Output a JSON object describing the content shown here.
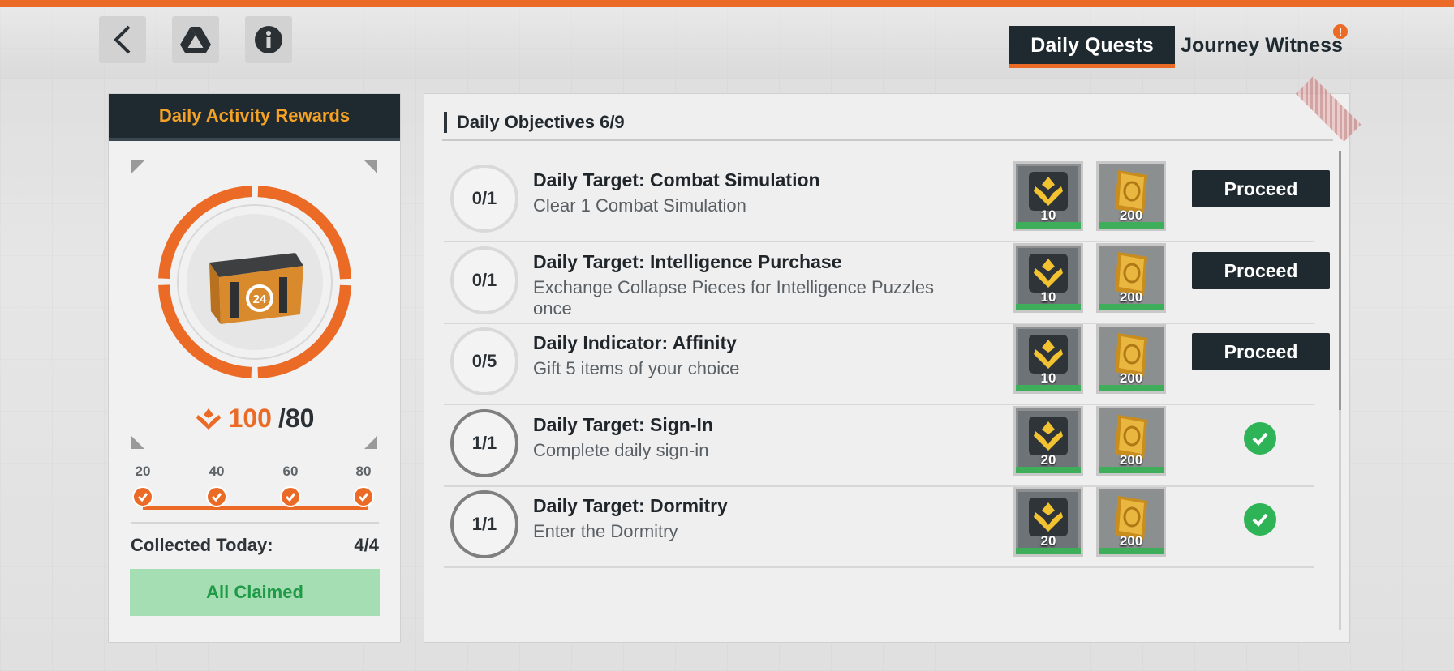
{
  "header": {
    "tabs": [
      {
        "label": "Daily Quests",
        "active": true
      },
      {
        "label": "Journey Witness",
        "active": false,
        "badge": "!"
      }
    ],
    "buttons": {
      "back_icon": "back-arrow-icon",
      "drive_icon": "drive-icon",
      "info_icon": "info-icon"
    }
  },
  "left_panel": {
    "title": "Daily Activity Rewards",
    "progress": {
      "current": "100",
      "total": "/80"
    },
    "milestones": [
      "20",
      "40",
      "60",
      "80"
    ],
    "collected_label": "Collected Today:",
    "collected_value": "4/4",
    "claim_button": "All Claimed"
  },
  "right_panel": {
    "title": "Daily Objectives 6/9",
    "objectives": [
      {
        "progress": "0/1",
        "title": "Daily Target: Combat Simulation",
        "desc": "Clear 1 Combat Simulation",
        "reward1": "10",
        "reward2": "200",
        "action": "Proceed",
        "done": false
      },
      {
        "progress": "0/1",
        "title": "Daily Target: Intelligence Purchase",
        "desc": "Exchange Collapse Pieces for Intelligence Puzzles once",
        "reward1": "10",
        "reward2": "200",
        "action": "Proceed",
        "done": false
      },
      {
        "progress": "0/5",
        "title": "Daily Indicator: Affinity",
        "desc": "Gift 5 items of your choice",
        "reward1": "10",
        "reward2": "200",
        "action": "Proceed",
        "done": false
      },
      {
        "progress": "1/1",
        "title": "Daily Target: Sign-In",
        "desc": "Complete daily sign-in",
        "reward1": "20",
        "reward2": "200",
        "action": "",
        "done": true
      },
      {
        "progress": "1/1",
        "title": "Daily Target: Dormitry",
        "desc": "Enter the Dormitry",
        "reward1": "20",
        "reward2": "200",
        "action": "",
        "done": true
      }
    ]
  },
  "colors": {
    "accent": "#ea6a26",
    "dark": "#1f2a30",
    "gold": "#f5a224",
    "success": "#2fb357"
  }
}
